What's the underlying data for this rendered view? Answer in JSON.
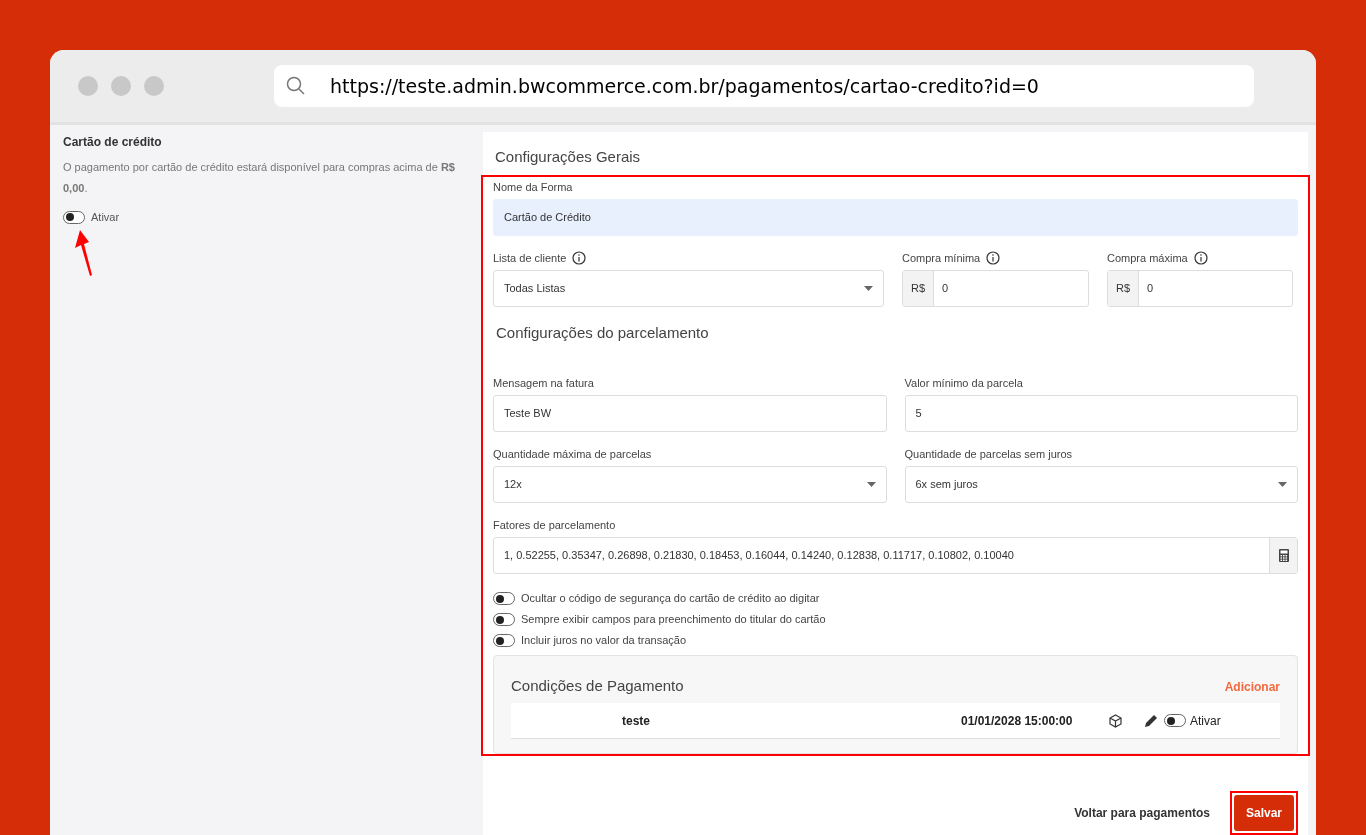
{
  "browser": {
    "url": "https://teste.admin.bwcommerce.com.br/pagamentos/cartao-credito?id=0"
  },
  "sidebar": {
    "title": "Cartão de crédito",
    "description": "O pagamento por cartão de crédito estará disponível para compras acima de **R$ 0,00**.",
    "toggle": {
      "label": "Ativar",
      "on": false
    }
  },
  "general": {
    "title": "Configurações Gerais",
    "name_field": {
      "label": "Nome da Forma",
      "value": "Cartão de Crédito"
    },
    "client_list": {
      "label": "Lista de cliente",
      "value": "Todas Listas"
    },
    "min_purchase": {
      "label": "Compra mínima",
      "prefix": "R$",
      "value": "0"
    },
    "max_purchase": {
      "label": "Compra máxima",
      "prefix": "R$",
      "value": "0"
    }
  },
  "installments": {
    "title": "Configurações do parcelamento",
    "invoice_message": {
      "label": "Mensagem na fatura",
      "value": "Teste BW"
    },
    "min_installment": {
      "label": "Valor mínimo da parcela",
      "value": "5"
    },
    "max_installments": {
      "label": "Quantidade máxima de parcelas",
      "value": "12x"
    },
    "interest_free": {
      "label": "Quantidade de parcelas sem juros",
      "value": "6x sem juros"
    },
    "factors": {
      "label": "Fatores de parcelamento",
      "value": "1, 0.52255, 0.35347, 0.26898, 0.21830, 0.18453, 0.16044, 0.14240, 0.12838, 0.11717, 0.10802, 0.10040"
    },
    "options": [
      {
        "label": "Ocultar o código de segurança do cartão de crédito ao digitar",
        "on": false
      },
      {
        "label": "Sempre exibir campos para preenchimento do titular do cartão",
        "on": false
      },
      {
        "label": "Incluir juros no valor da transação",
        "on": false
      }
    ]
  },
  "conditions": {
    "title": "Condições de Pagamento",
    "add_link": "Adicionar",
    "rows": [
      {
        "name": "teste",
        "date": "01/01/2028 15:00:00",
        "toggle_label": "Ativar",
        "on": false
      }
    ]
  },
  "footer": {
    "back": "Voltar para pagamentos",
    "save": "Salvar"
  }
}
